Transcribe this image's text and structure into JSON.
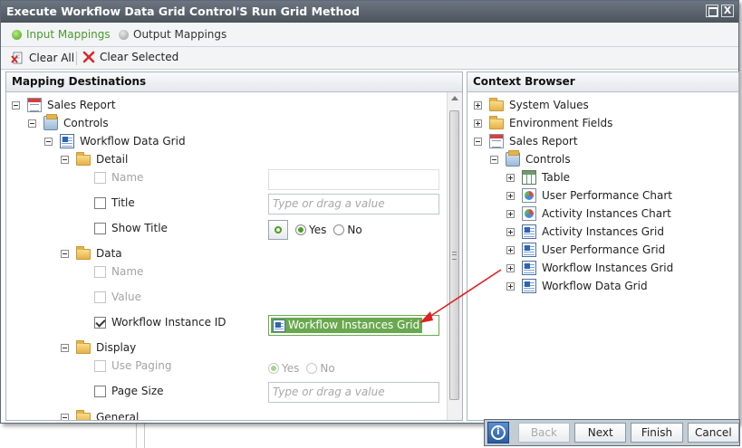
{
  "window": {
    "title": "Execute Workflow Data Grid Control'S Run Grid Method",
    "close_glyph": "X"
  },
  "tabs": [
    {
      "label": "Input Mappings",
      "active": true
    },
    {
      "label": "Output Mappings",
      "active": false
    }
  ],
  "toolbar": {
    "clear_all": "Clear All",
    "clear_selected": "Clear Selected"
  },
  "mapping_destinations": {
    "header": "Mapping Destinations",
    "root": "Sales Report",
    "controls": "Controls",
    "control": "Workflow Data Grid",
    "sections": {
      "detail": "Detail",
      "data": "Data",
      "display": "Display",
      "general": "General"
    },
    "fields": {
      "detail_name": "Name",
      "detail_title": "Title",
      "detail_show_title": "Show Title",
      "data_name": "Name",
      "data_value": "Value",
      "data_workflow_instance_id": "Workflow Instance ID",
      "display_use_paging": "Use Paging",
      "display_page_size": "Page Size"
    },
    "placeholder": "Type or drag a value",
    "show_title_options": {
      "yes": "Yes",
      "no": "No",
      "selected": "Yes"
    },
    "use_paging_options": {
      "yes": "Yes",
      "no": "No",
      "selected": "Yes"
    },
    "workflow_instance_id_value": "Workflow Instances Grid"
  },
  "context_browser": {
    "header": "Context Browser",
    "items": [
      {
        "label": "System Values"
      },
      {
        "label": "Environment Fields"
      },
      {
        "label": "Sales Report"
      },
      {
        "label": "Controls"
      },
      {
        "label": "Table"
      },
      {
        "label": "User Performance Chart"
      },
      {
        "label": "Activity Instances Chart"
      },
      {
        "label": "Activity Instances Grid"
      },
      {
        "label": "User Performance Grid"
      },
      {
        "label": "Workflow Instances Grid"
      },
      {
        "label": "Workflow Data Grid"
      }
    ]
  },
  "footer": {
    "info_glyph": "i",
    "back": "Back",
    "next": "Next",
    "finish": "Finish",
    "cancel": "Cancel"
  },
  "colors": {
    "titlebar": "#5c646d",
    "accent_green": "#6aa84f",
    "arrow_red": "#e02020"
  }
}
